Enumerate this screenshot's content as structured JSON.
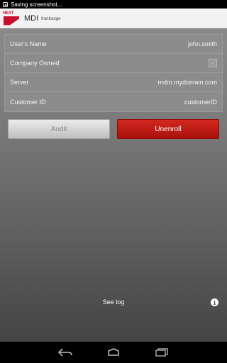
{
  "status_bar": {
    "text": "Saving screenshot..."
  },
  "action_bar": {
    "logo_text": "HEAT",
    "title": "MDI",
    "subtitle": "frontrange"
  },
  "info": {
    "rows": [
      {
        "label": "User's Name",
        "value": "john.smith"
      },
      {
        "label": "Company Owned",
        "value": ""
      },
      {
        "label": "Server",
        "value": "mdm.mydomain.com"
      },
      {
        "label": "Customer ID",
        "value": "customerID"
      }
    ]
  },
  "buttons": {
    "audit": "Audit",
    "unenroll": "Unenroll"
  },
  "footer": {
    "see_log": "See log",
    "info_icon_glyph": "i"
  },
  "icons": {
    "status": "image-icon",
    "back": "back-icon",
    "home": "home-icon",
    "recents": "recents-icon"
  }
}
